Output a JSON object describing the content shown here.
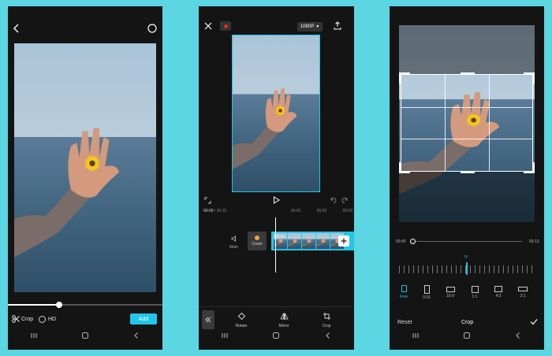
{
  "colors": {
    "background": "#5cd6e2",
    "phone_bg": "#141414",
    "accent": "#1fc7e8",
    "record_red": "#e02d2d"
  },
  "screen1": {
    "crop_label": "Crop",
    "hd_label": "HD",
    "add_button": "Add",
    "slider_value": 0.33
  },
  "screen2": {
    "resolution": "1080P",
    "time_current": "00:00",
    "time_total": "00:15",
    "ruler_marks": [
      "00:01",
      "00:02",
      "00:03"
    ],
    "track_label": "Main",
    "cover_label": "Cover",
    "clip_time": "15.0s",
    "tools": [
      {
        "label": "Rotate",
        "icon": "rotate-icon"
      },
      {
        "label": "Mirror",
        "icon": "mirror-icon"
      },
      {
        "label": "Crop",
        "icon": "crop-icon"
      }
    ]
  },
  "screen3": {
    "time_start": "00:00",
    "time_end": "00:13",
    "rotation_value": "0°",
    "ratios": [
      {
        "label": "Free",
        "selected": true
      },
      {
        "label": "9:16",
        "selected": false
      },
      {
        "label": "16:9",
        "selected": false
      },
      {
        "label": "1:1",
        "selected": false
      },
      {
        "label": "4:3",
        "selected": false
      },
      {
        "label": "2:1",
        "selected": false
      }
    ],
    "reset_label": "Reset",
    "title": "Crop"
  }
}
